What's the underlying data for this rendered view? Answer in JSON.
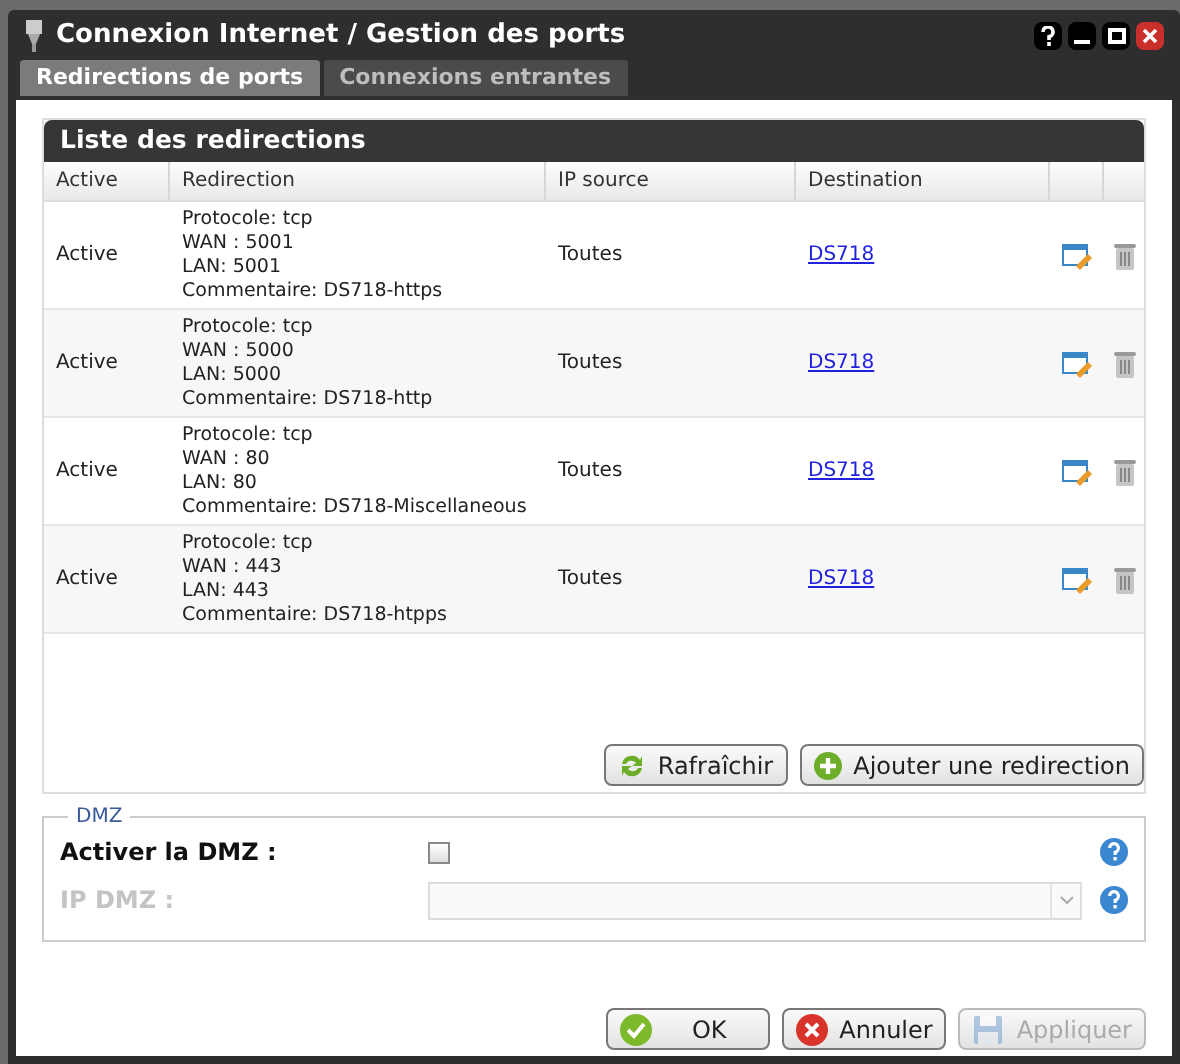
{
  "window": {
    "title": "Connexion Internet / Gestion des ports"
  },
  "tabs": [
    {
      "label": "Redirections de ports",
      "selected": true
    },
    {
      "label": "Connexions entrantes",
      "selected": false
    }
  ],
  "panel": {
    "title": "Liste des redirections"
  },
  "table": {
    "columns": [
      "Active",
      "Redirection",
      "IP source",
      "Destination"
    ],
    "rows": [
      {
        "active": "Active",
        "redirection": [
          "Protocole: tcp",
          "WAN : 5001",
          "LAN: 5001",
          "Commentaire: DS718-https"
        ],
        "ip_source": "Toutes",
        "destination": "DS718"
      },
      {
        "active": "Active",
        "redirection": [
          "Protocole: tcp",
          "WAN : 5000",
          "LAN: 5000",
          "Commentaire: DS718-http"
        ],
        "ip_source": "Toutes",
        "destination": "DS718"
      },
      {
        "active": "Active",
        "redirection": [
          "Protocole: tcp",
          "WAN : 80",
          "LAN: 80",
          "Commentaire: DS718-Miscellaneous"
        ],
        "ip_source": "Toutes",
        "destination": "DS718"
      },
      {
        "active": "Active",
        "redirection": [
          "Protocole: tcp",
          "WAN : 443",
          "LAN: 443",
          "Commentaire: DS718-htpps"
        ],
        "ip_source": "Toutes",
        "destination": "DS718"
      }
    ]
  },
  "table_buttons": [
    {
      "label": "Rafraîchir",
      "kind": "refresh"
    },
    {
      "label": "Ajouter une redirection",
      "kind": "add"
    }
  ],
  "dmz": {
    "legend": "DMZ",
    "enable_label": "Activer la DMZ :",
    "checked": false,
    "ip_label": "IP DMZ :",
    "ip_disabled": true
  },
  "footer_buttons": [
    {
      "label": "OK",
      "kind": "ok",
      "disabled": false
    },
    {
      "label": "Annuler",
      "kind": "cancel",
      "disabled": false
    },
    {
      "label": "Appliquer",
      "kind": "save",
      "disabled": true
    }
  ]
}
